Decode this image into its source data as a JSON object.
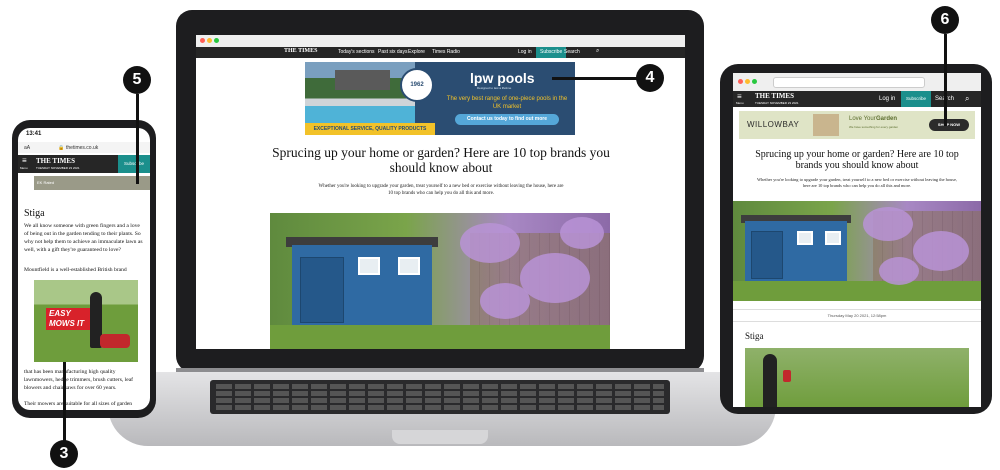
{
  "laptop": {
    "nav": {
      "logo": "THE TIMES",
      "items": [
        "Today's sections",
        "Past six days",
        "Explore",
        "Times Radio"
      ],
      "login": "Log in",
      "subscribe": "Subscribe",
      "search": "Search"
    },
    "ad": {
      "badge_year": "1962",
      "brand": "lpw pools",
      "tagline": "Designed to last a lifetime",
      "copy": "The very best range of one-piece pools in the UK market",
      "cta": "Contact us today to find out more",
      "strap": "EXCEPTIONAL SERVICE, QUALITY PRODUCTS"
    },
    "headline": "Sprucing up your home or garden? Here are 10 top brands you should know about",
    "standfirst": "Whether you're looking to upgrade your garden, treat yourself to a new bed or exercise without leaving the house, here are 10 top brands who can help you do all this and more."
  },
  "phone": {
    "time": "13:41",
    "url_prefix": "aA",
    "url": "thetimes.co.uk",
    "logo": "THE TIMES",
    "date": "TUESDAY NOVEMBER 23 2021",
    "menu": "Menu",
    "subscribe": "Subscribe",
    "banner_text": "EK Rated",
    "heading": "Stiga",
    "para1": "We all know someone with green fingers and a love of being out in the garden tending to their plants. So why not help them to achieve an immaculate lawn as well, with a gift they're guaranteed to love?",
    "para2": "Mountfield is a well-established British brand",
    "ad_text": "EASY MOWS IT",
    "para3": "that has been manufacturing high quality lawnmowers, hedge trimmers, brush cutters, leaf blowers and chainsaws for over 60 years.",
    "para4": "Their mowers are suitable for all sizes of garden"
  },
  "tablet": {
    "logo": "THE TIMES",
    "date": "TUESDAY NOVEMBER 23 2021",
    "menu": "Menu",
    "login": "Log in",
    "subscribe": "Subscribe",
    "search": "Search",
    "ad": {
      "brand": "WILLOWBAY",
      "title_a": "Love Your",
      "title_b": "Garden",
      "sub": "We have something for every garden",
      "cta": "SHOP NOW"
    },
    "headline": "Sprucing up your home or garden? Here are 10 top brands you should know about",
    "standfirst": "Whether you're looking to upgrade your garden, treat yourself to a new bed or exercise without leaving the house, here are 10 top brands who can help you do all this and more.",
    "timestamp": "Thursday May 20 2021, 12:58pm",
    "heading": "Stiga"
  },
  "callouts": {
    "three": "3",
    "four": "4",
    "five": "5",
    "six": "6"
  },
  "colors": {
    "times_nav": "#262626",
    "subscribe": "#1b8f8c",
    "lpw_blue": "#2b4d72",
    "lpw_yellow": "#f2c229",
    "callout": "#111111"
  }
}
